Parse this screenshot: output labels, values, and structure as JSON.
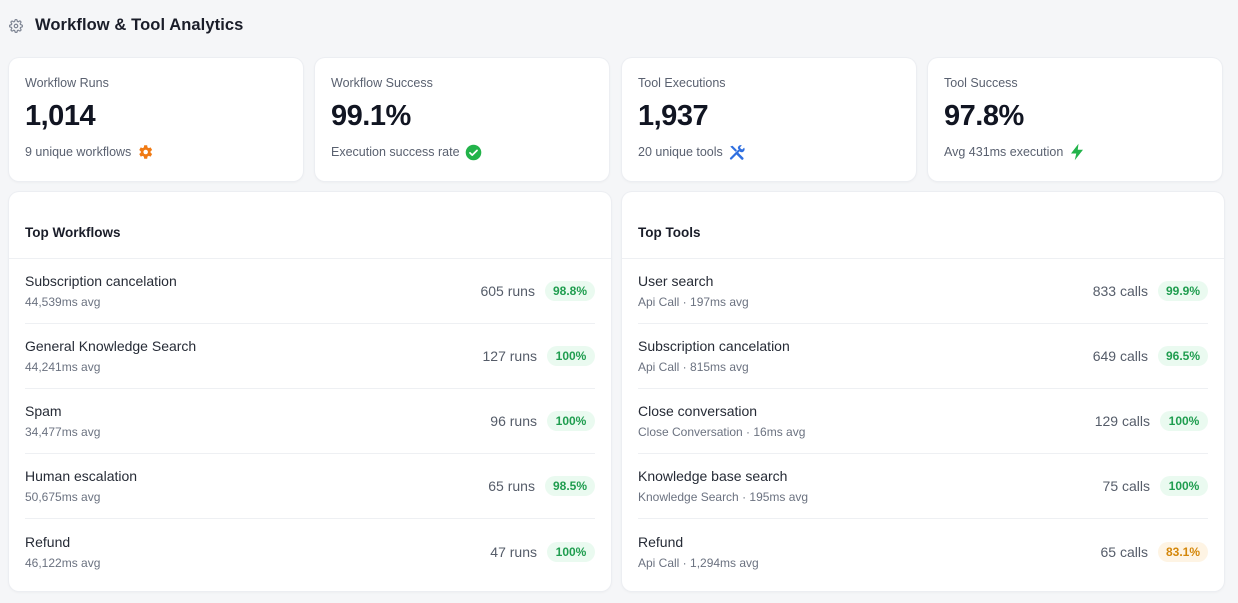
{
  "header": {
    "title": "Workflow & Tool Analytics",
    "icon": "gear-icon"
  },
  "stats": [
    {
      "label": "Workflow Runs",
      "value": "1,014",
      "sub": "9 unique workflows",
      "icon": "gear-icon",
      "icon_color": "#f07a14"
    },
    {
      "label": "Workflow Success",
      "value": "99.1%",
      "sub": "Execution success rate",
      "icon": "check-circle-icon",
      "icon_color": "#22b34a"
    },
    {
      "label": "Tool Executions",
      "value": "1,937",
      "sub": "20 unique tools",
      "icon": "wrench-screwdriver-icon",
      "icon_color": "#2f6fe0"
    },
    {
      "label": "Tool Success",
      "value": "97.8%",
      "sub": "Avg 431ms execution",
      "icon": "lightning-icon",
      "icon_color": "#22b34a"
    }
  ],
  "top_workflows": {
    "title": "Top Workflows",
    "rows": [
      {
        "name": "Subscription cancelation",
        "meta": "44,539ms avg",
        "count": "605 runs",
        "rate": "98.8%",
        "status": "good"
      },
      {
        "name": "General Knowledge Search",
        "meta": "44,241ms avg",
        "count": "127 runs",
        "rate": "100%",
        "status": "good"
      },
      {
        "name": "Spam",
        "meta": "34,477ms avg",
        "count": "96 runs",
        "rate": "100%",
        "status": "good"
      },
      {
        "name": "Human escalation",
        "meta": "50,675ms avg",
        "count": "65 runs",
        "rate": "98.5%",
        "status": "good"
      },
      {
        "name": "Refund",
        "meta": "46,122ms avg",
        "count": "47 runs",
        "rate": "100%",
        "status": "good"
      }
    ]
  },
  "top_tools": {
    "title": "Top Tools",
    "rows": [
      {
        "name": "User search",
        "meta": "Api Call · 197ms avg",
        "count": "833 calls",
        "rate": "99.9%",
        "status": "good"
      },
      {
        "name": "Subscription cancelation",
        "meta": "Api Call · 815ms avg",
        "count": "649 calls",
        "rate": "96.5%",
        "status": "good"
      },
      {
        "name": "Close conversation",
        "meta": "Close Conversation · 16ms avg",
        "count": "129 calls",
        "rate": "100%",
        "status": "good"
      },
      {
        "name": "Knowledge base search",
        "meta": "Knowledge Search · 195ms avg",
        "count": "75 calls",
        "rate": "100%",
        "status": "good"
      },
      {
        "name": "Refund",
        "meta": "Api Call · 1,294ms avg",
        "count": "65 calls",
        "rate": "83.1%",
        "status": "warn"
      }
    ]
  },
  "colors": {
    "good": "#1f9d4f",
    "warn": "#d4870a",
    "background": "#f5f6f8"
  }
}
